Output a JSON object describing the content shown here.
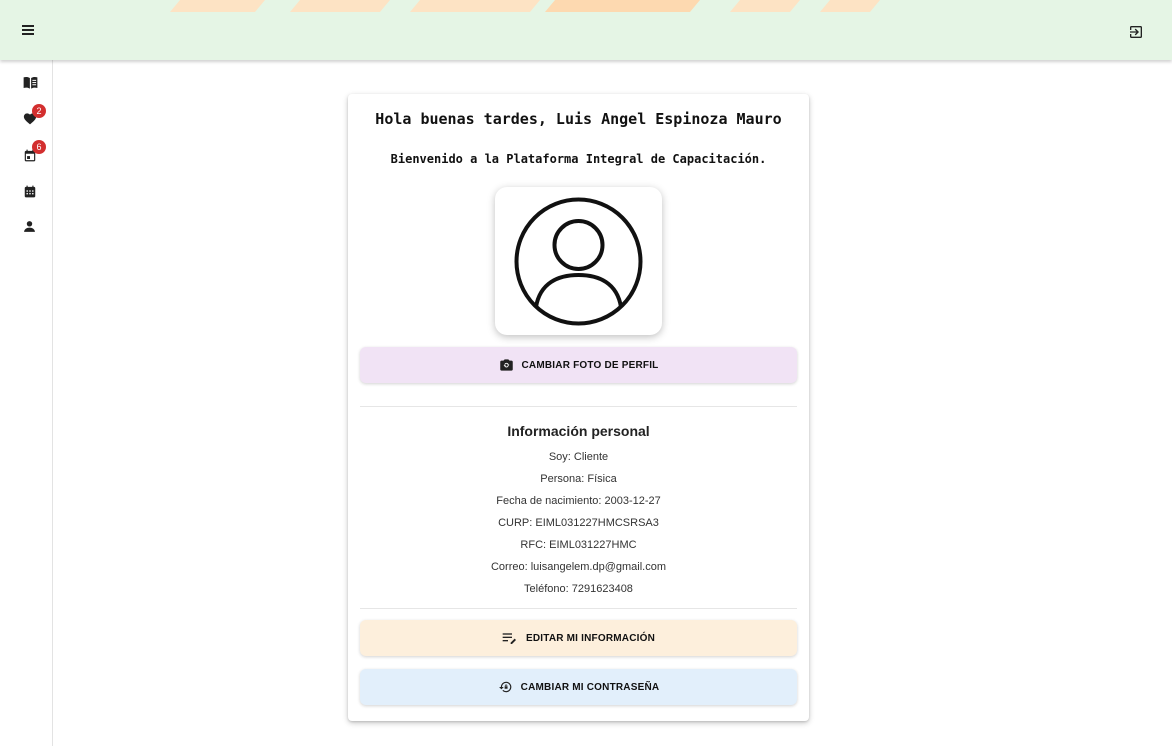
{
  "header": {
    "menu_icon": "hamburger-icon",
    "logout_icon": "logout-icon",
    "accent_colors": [
      "#fde3c4",
      "#fdd9b0"
    ]
  },
  "sidebar": {
    "items": [
      {
        "icon": "book-icon"
      },
      {
        "icon": "heart-icon",
        "badge": "2"
      },
      {
        "icon": "calendar-check-icon",
        "badge": "6"
      },
      {
        "icon": "calendar-icon"
      },
      {
        "icon": "person-icon"
      }
    ],
    "badge_color": "#d32f2f"
  },
  "profile": {
    "greeting": "Hola buenas tardes, Luis Angel Espinoza Mauro",
    "welcome": "Bienvenido a la Plataforma Integral de Capacitación.",
    "avatar_icon": "account-circle-icon",
    "change_photo_label": "CAMBIAR FOTO DE PERFIL",
    "change_photo_icon": "camera-switch-icon"
  },
  "personal_info": {
    "title": "Información personal",
    "lines": [
      "Soy: Cliente",
      "Persona: Física",
      "Fecha de nacimiento: 2003-12-27",
      "CURP: EIML031227HMCSRSA3",
      "RFC: EIML031227HMC",
      "Correo: luisangelem.dp@gmail.com",
      "Teléfono: 7291623408"
    ]
  },
  "actions": {
    "edit_label": "EDITAR MI INFORMACIÓN",
    "edit_icon": "edit-note-icon",
    "edit_color": "#fdefdc",
    "password_label": "CAMBIAR MI CONTRASEÑA",
    "password_icon": "lock-reset-icon",
    "password_color": "#e2effb",
    "photo_color": "#f1e3f5"
  }
}
